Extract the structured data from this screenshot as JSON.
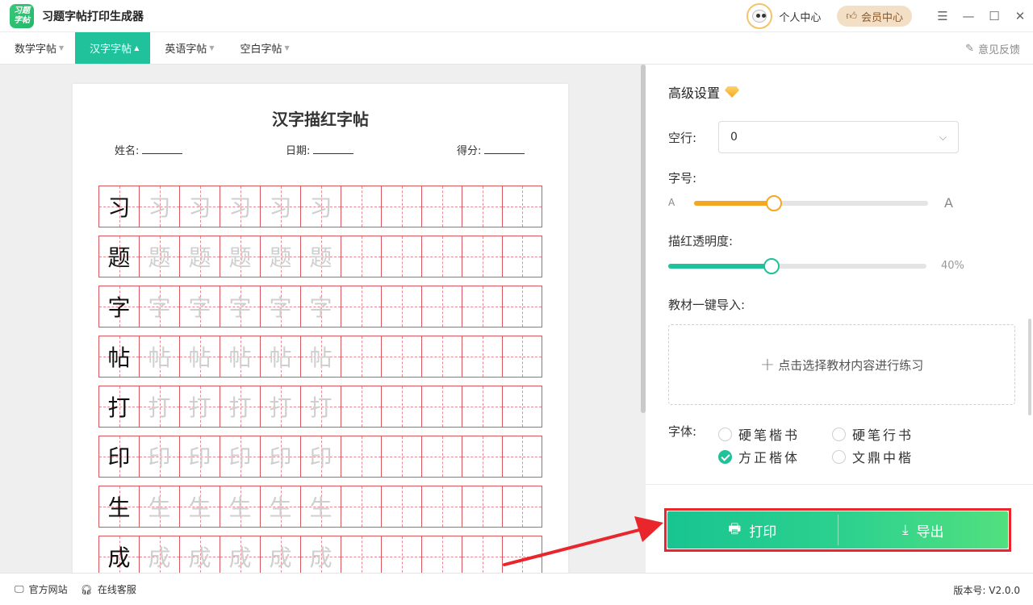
{
  "app": {
    "logo_text_1": "习题",
    "logo_text_2": "字帖",
    "title": "习题字帖打印生成器",
    "personal_center": "个人中心",
    "vip_center": "会员中心"
  },
  "tabs": [
    {
      "label": "数学字帖",
      "active": false
    },
    {
      "label": "汉字字帖",
      "active": true
    },
    {
      "label": "英语字帖",
      "active": false
    },
    {
      "label": "空白字帖",
      "active": false
    }
  ],
  "feedback": "意见反馈",
  "sheet": {
    "title": "汉字描红字帖",
    "name_label": "姓名:",
    "date_label": "日期:",
    "score_label": "得分:",
    "characters": [
      "习",
      "题",
      "字",
      "帖",
      "打",
      "印",
      "生",
      "成"
    ],
    "trace_count": 5,
    "cells_per_row": 11
  },
  "settings": {
    "section_title": "高级设置",
    "blank_rows_label": "空行:",
    "blank_rows_value": "0",
    "font_size_label": "字号:",
    "font_size_min_glyph": "A",
    "font_size_max_glyph": "A",
    "font_size_level": 0.34,
    "opacity_label": "描红透明度:",
    "opacity_value": "40%",
    "opacity_level": 0.4,
    "import_label": "教材一键导入:",
    "import_button": "点击选择教材内容进行练习",
    "font_label": "字体:",
    "fonts": [
      {
        "label": "硬笔楷书",
        "selected": false
      },
      {
        "label": "硬笔行书",
        "selected": false
      },
      {
        "label": "方正楷体",
        "selected": true
      },
      {
        "label": "文鼎中楷",
        "selected": false
      }
    ],
    "print_label": "打印",
    "export_label": "导出"
  },
  "footer": {
    "official_site": "官方网站",
    "online_service": "在线客服",
    "version": "版本号: V2.0.0"
  },
  "colors": {
    "accent": "#1fc29a",
    "slider_orange": "#f5a623",
    "grid_red": "#d9575f",
    "highlight_red": "#e8262b"
  }
}
